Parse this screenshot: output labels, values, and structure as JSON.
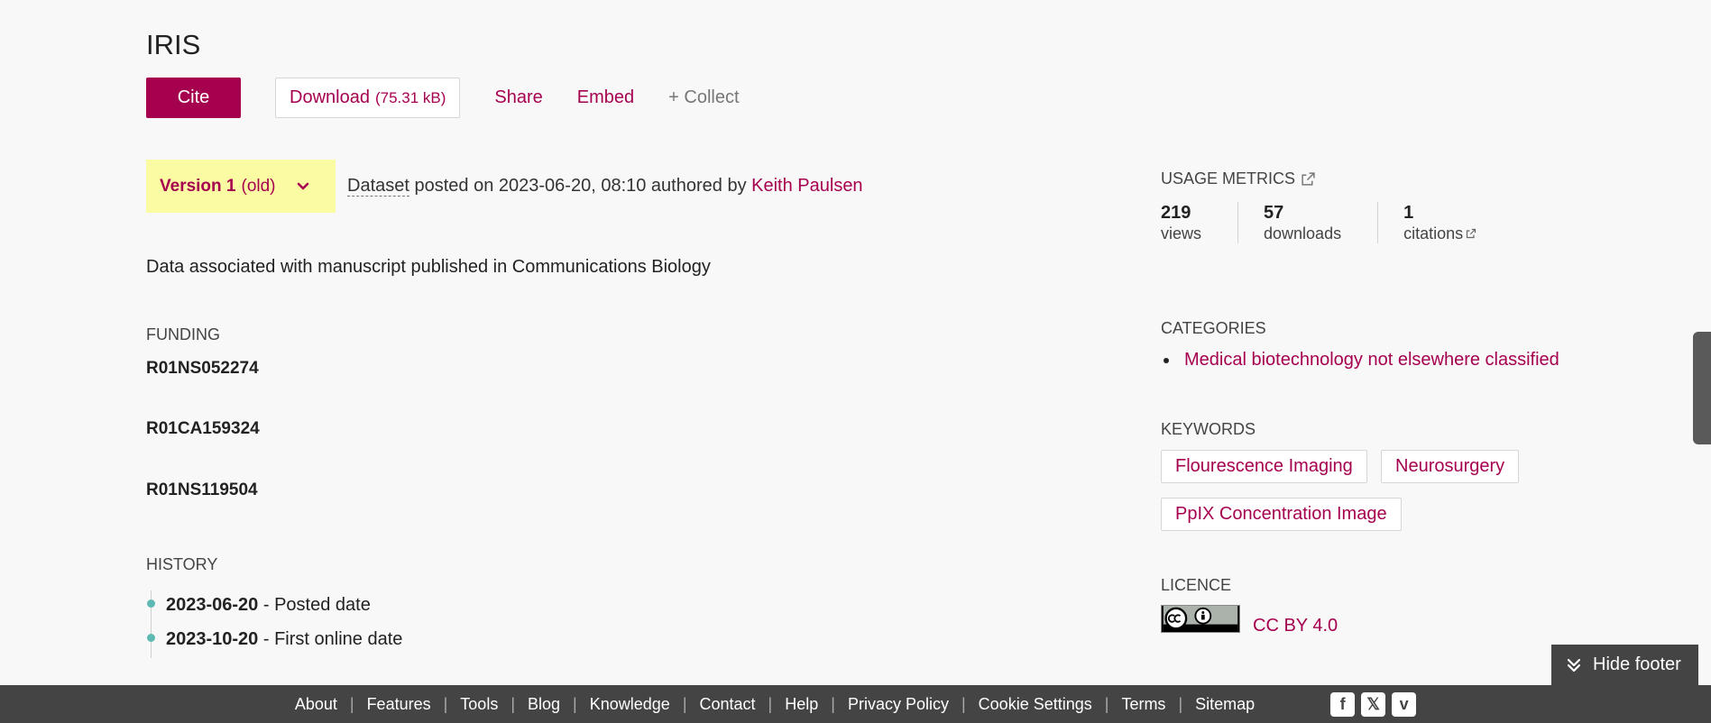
{
  "title": "IRIS",
  "actions": {
    "cite": "Cite",
    "download": "Download",
    "download_size": "(75.31 kB)",
    "share": "Share",
    "embed": "Embed",
    "collect": "+ Collect"
  },
  "version": {
    "label": "Version 1",
    "status": "(old)"
  },
  "posted": {
    "type": "Dataset",
    "text": "posted on 2023-06-20, 08:10 authored by",
    "author": "Keith Paulsen"
  },
  "description": "Data associated with manuscript published in Communications Biology",
  "funding": {
    "label": "FUNDING",
    "items": [
      "R01NS052274",
      "R01CA159324",
      "R01NS119504"
    ]
  },
  "history": {
    "label": "HISTORY",
    "items": [
      {
        "date": "2023-06-20",
        "text": "- Posted date"
      },
      {
        "date": "2023-10-20",
        "text": "- First online date"
      }
    ]
  },
  "usage": {
    "label": "USAGE METRICS",
    "metrics": [
      {
        "value": "219",
        "label": "views"
      },
      {
        "value": "57",
        "label": "downloads"
      },
      {
        "value": "1",
        "label": "citations"
      }
    ]
  },
  "categories": {
    "label": "CATEGORIES",
    "items": [
      "Medical biotechnology not elsewhere classified"
    ]
  },
  "keywords": {
    "label": "KEYWORDS",
    "items": [
      "Flourescence Imaging",
      "Neurosurgery",
      "PpIX Concentration Image"
    ]
  },
  "licence": {
    "label": "LICENCE",
    "name": "CC BY 4.0",
    "badge_icon": "cc-by-badge-icon"
  },
  "hide_footer": "Hide footer",
  "footer": {
    "links": [
      "About",
      "Features",
      "Tools",
      "Blog",
      "Knowledge",
      "Contact",
      "Help",
      "Privacy Policy",
      "Cookie Settings",
      "Terms",
      "Sitemap"
    ],
    "socials": [
      "facebook-icon",
      "x-icon",
      "vimeo-icon"
    ]
  },
  "colors": {
    "accent": "#a6014f",
    "version_bg": "#fbfba4",
    "footer_bg": "#444444",
    "history_dot": "#5fb9b3"
  }
}
